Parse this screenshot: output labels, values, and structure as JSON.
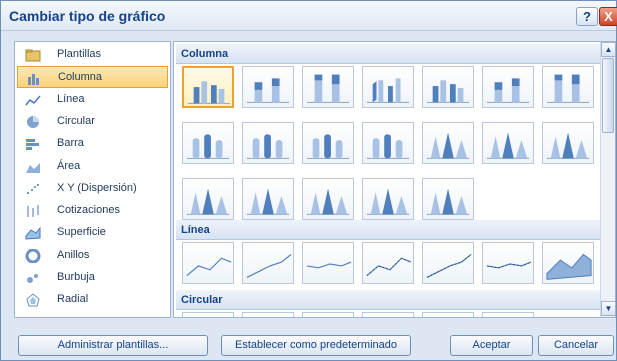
{
  "window": {
    "title": "Cambiar tipo de gráfico",
    "help_label": "?",
    "close_label": "X"
  },
  "categories": [
    {
      "label": "Plantillas",
      "icon": "folder-icon"
    },
    {
      "label": "Columna",
      "icon": "column-chart-icon",
      "selected": true
    },
    {
      "label": "Línea",
      "icon": "line-chart-icon"
    },
    {
      "label": "Circular",
      "icon": "pie-chart-icon"
    },
    {
      "label": "Barra",
      "icon": "bar-chart-icon"
    },
    {
      "label": "Área",
      "icon": "area-chart-icon"
    },
    {
      "label": "X Y (Dispersión)",
      "icon": "scatter-chart-icon"
    },
    {
      "label": "Cotizaciones",
      "icon": "stock-chart-icon"
    },
    {
      "label": "Superficie",
      "icon": "surface-chart-icon"
    },
    {
      "label": "Anillos",
      "icon": "doughnut-chart-icon"
    },
    {
      "label": "Burbuja",
      "icon": "bubble-chart-icon"
    },
    {
      "label": "Radial",
      "icon": "radar-chart-icon"
    }
  ],
  "sections": [
    {
      "label": "Columna",
      "count": 19
    },
    {
      "label": "Línea",
      "count": 7
    },
    {
      "label": "Circular",
      "count": 6
    }
  ],
  "buttons": {
    "manage_templates": "Administrar plantillas...",
    "set_default": "Establecer como predeterminado",
    "accept": "Aceptar",
    "cancel": "Cancelar"
  }
}
